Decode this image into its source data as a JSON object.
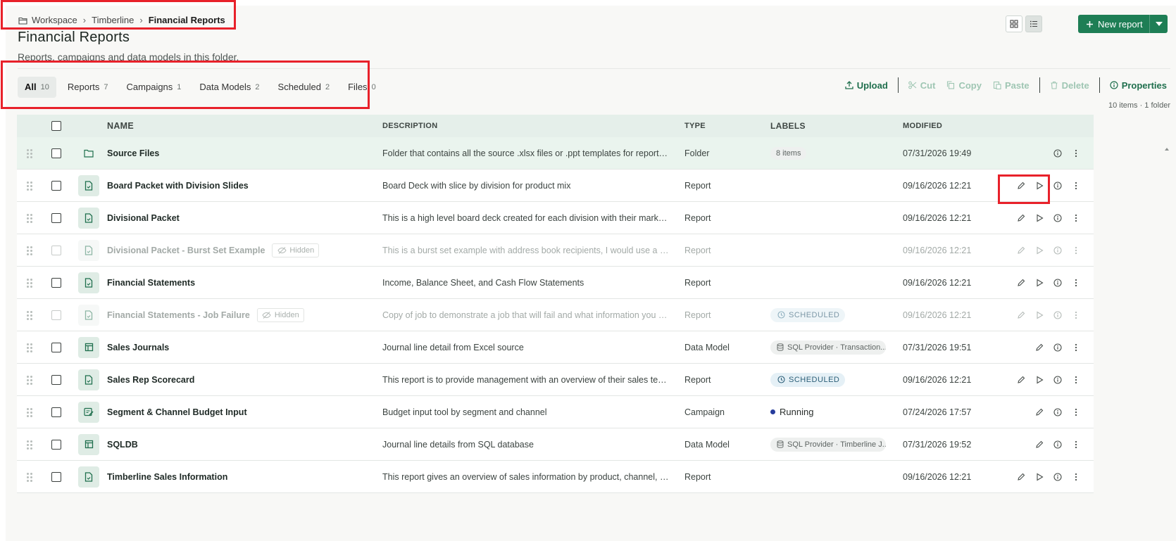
{
  "breadcrumb": {
    "workspace": "Workspace",
    "folder": "Timberline",
    "current": "Financial Reports"
  },
  "page": {
    "title": "Financial Reports",
    "subtitle": "Reports, campaigns and data models in this folder."
  },
  "new_report_label": "New report",
  "tabs": [
    {
      "label": "All",
      "count": "10",
      "active": true
    },
    {
      "label": "Reports",
      "count": "7"
    },
    {
      "label": "Campaigns",
      "count": "1"
    },
    {
      "label": "Data Models",
      "count": "2"
    },
    {
      "label": "Scheduled",
      "count": "2"
    },
    {
      "label": "Files",
      "count": "0"
    }
  ],
  "actions": {
    "upload": "Upload",
    "cut": "Cut",
    "copy": "Copy",
    "paste": "Paste",
    "delete": "Delete",
    "properties": "Properties"
  },
  "item_count": "10 items · 1 folder",
  "columns": {
    "name": "NAME",
    "description": "DESCRIPTION",
    "type": "TYPE",
    "labels": "LABELS",
    "modified": "MODIFIED"
  },
  "rows": [
    {
      "name": "Source Files",
      "description": "Folder that contains all the source .xlsx files or .ppt templates for reports in Timberline",
      "type": "Folder",
      "label": "8 items",
      "modified": "07/31/2026 19:49"
    },
    {
      "name": "Board Packet with Division Slides",
      "description": "Board Deck with slice by division for product mix",
      "type": "Report",
      "label": "",
      "modified": "09/16/2026 12:21"
    },
    {
      "name": "Divisional Packet",
      "description": "This is a high level board deck created for each division with their markets revenue",
      "type": "Report",
      "label": "",
      "modified": "09/16/2026 12:21"
    },
    {
      "name": "Divisional Packet - Burst Set Example",
      "hidden_label": "Hidden",
      "description": "This is a burst set example with address book recipients, I would use a burst set",
      "type": "Report",
      "label": "",
      "modified": "09/16/2026 12:21"
    },
    {
      "name": "Financial Statements",
      "description": "Income, Balance Sheet, and Cash Flow Statements",
      "type": "Report",
      "label": "",
      "modified": "09/16/2026 12:21"
    },
    {
      "name": "Financial Statements - Job Failure",
      "hidden_label": "Hidden",
      "description": "Copy of job to demonstrate a job that will fail and what information you get when",
      "type": "Report",
      "label": "SCHEDULED",
      "modified": "09/16/2026 12:21"
    },
    {
      "name": "Sales Journals",
      "description": "Journal line detail from Excel source",
      "type": "Data Model",
      "label": "SQL Provider · Transaction...",
      "modified": "07/31/2026 19:51"
    },
    {
      "name": "Sales Rep Scorecard",
      "description": "This report is to provide management with an overview of their sales team and",
      "type": "Report",
      "label": "SCHEDULED",
      "modified": "09/16/2026 12:21"
    },
    {
      "name": "Segment & Channel Budget Input",
      "description": "Budget input tool by segment and channel",
      "type": "Campaign",
      "label": "Running",
      "modified": "07/24/2026 17:57"
    },
    {
      "name": "SQLDB",
      "description": "Journal line details from SQL database",
      "type": "Data Model",
      "label": "SQL Provider · Timberline J...",
      "modified": "07/31/2026 19:52"
    },
    {
      "name": "Timberline Sales Information",
      "description": "This report gives an overview of sales information by product, channel, and location",
      "type": "Report",
      "label": "",
      "modified": "09/16/2026 12:21"
    }
  ],
  "colors": {
    "accent": "#1e7e55",
    "annotation": "#e8212a",
    "running_dot": "#263c9c"
  }
}
